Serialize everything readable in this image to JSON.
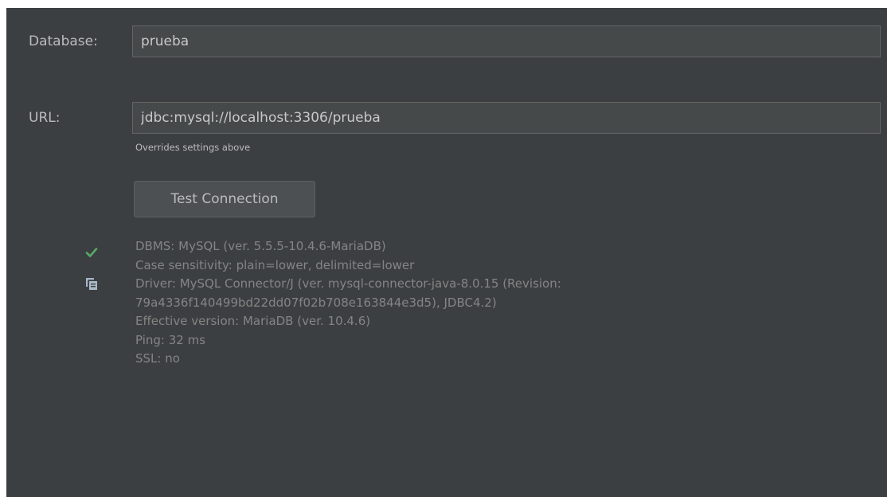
{
  "form": {
    "database_label": "Database:",
    "database_value": "prueba",
    "url_label": "URL:",
    "url_value": "jdbc:mysql://localhost:3306/prueba",
    "url_hint": "Overrides settings above"
  },
  "test_button": {
    "label": "Test Connection"
  },
  "icons": {
    "status": "checkmark-icon",
    "copy": "copy-icon",
    "status_color": "#59a869"
  },
  "result": {
    "lines": [
      "DBMS: MySQL (ver. 5.5.5-10.4.6-MariaDB)",
      "Case sensitivity: plain=lower, delimited=lower",
      "Driver: MySQL Connector/J (ver. mysql-connector-java-8.0.15 (Revision:",
      "79a4336f140499bd22dd07f02b708e163844e3d5), JDBC4.2)",
      "Effective version: MariaDB (ver. 10.4.6)",
      "Ping: 32 ms",
      "SSL: no"
    ]
  }
}
